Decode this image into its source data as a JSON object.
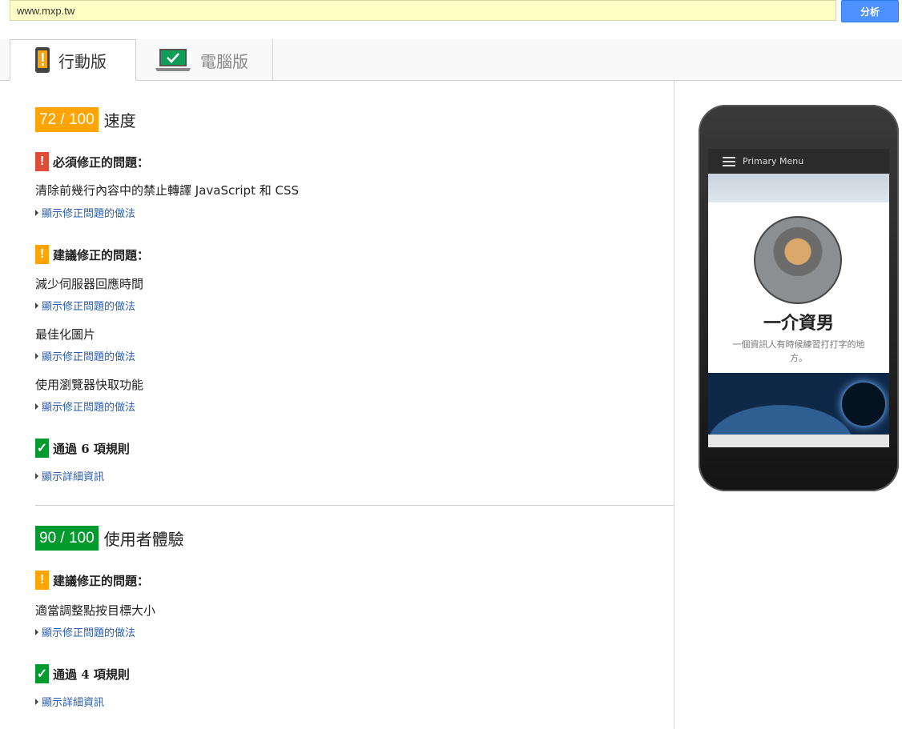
{
  "search": {
    "url": "www.mxp.tw",
    "analyze_label": "分析"
  },
  "tabs": [
    {
      "label": "行動版"
    },
    {
      "label": "電腦版"
    }
  ],
  "speed": {
    "score": "72 / 100",
    "label": "速度",
    "must_fix": {
      "heading": "必須修正的問題：",
      "items": [
        {
          "text": "清除前幾行內容中的禁止轉譯 JavaScript 和 CSS",
          "link": "顯示修正問題的做法"
        }
      ]
    },
    "should_fix": {
      "heading": "建議修正的問題：",
      "items": [
        {
          "text": "減少伺服器回應時間",
          "link": "顯示修正問題的做法"
        },
        {
          "text": "最佳化圖片",
          "link": "顯示修正問題的做法"
        },
        {
          "text": "使用瀏覽器快取功能",
          "link": "顯示修正問題的做法"
        }
      ]
    },
    "passed": {
      "heading": "通過 6 項規則",
      "link": "顯示詳細資訊"
    }
  },
  "ux": {
    "score": "90 / 100",
    "label": "使用者體驗",
    "should_fix": {
      "heading": "建議修正的問題：",
      "items": [
        {
          "text": "適當調整點按目標大小",
          "link": "顯示修正問題的做法"
        }
      ]
    },
    "passed": {
      "heading": "通過 4 項規則",
      "link": "顯示詳細資訊"
    }
  },
  "preview": {
    "menu_label": "Primary Menu",
    "site_name": "一介資男",
    "tagline": "一個資訊人有時候練習打打字的地方。"
  },
  "colors": {
    "orange": "#ffa400",
    "green": "#009a2d",
    "red": "#dd4b39",
    "link": "#2a5db0"
  },
  "icons": {
    "mobile_tab": "mobile-phone-icon",
    "desktop_tab": "laptop-check-icon"
  }
}
